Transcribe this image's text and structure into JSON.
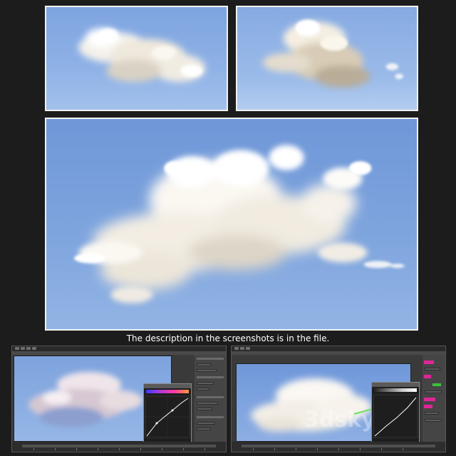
{
  "caption": "The description in the screenshots is in the file.",
  "watermark": "3dsky",
  "colors": {
    "frame_border": "#f2f2f2",
    "background": "#1c1c1c",
    "sky_blue": "#7fa5de",
    "ui_gray": "#3a3a3a",
    "accent_magenta": "#e0259a",
    "accent_green": "#3ac23a",
    "curve_line": "#ffffff"
  },
  "panels": {
    "top_left": {
      "kind": "cloud-render"
    },
    "top_right": {
      "kind": "cloud-render"
    },
    "main": {
      "kind": "cloud-render"
    },
    "bottom_left": {
      "kind": "software-screenshot",
      "has_curve_editor": true,
      "curve_gradient": "color"
    },
    "bottom_right": {
      "kind": "software-screenshot",
      "has_curve_editor": true,
      "curve_gradient": "grayscale",
      "has_watermark": true
    }
  },
  "icons": [
    "curve-editor-icon",
    "timeline-icon",
    "toolbar-icon"
  ]
}
